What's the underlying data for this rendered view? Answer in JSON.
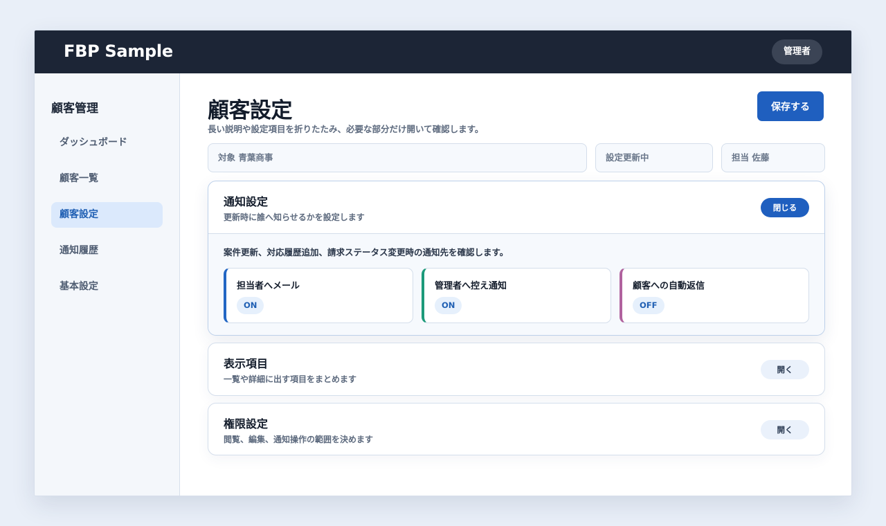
{
  "header": {
    "brand": "FBP Sample",
    "role": "管理者"
  },
  "sidebar": {
    "heading": "顧客管理",
    "items": [
      {
        "label": "ダッシュボード",
        "active": false
      },
      {
        "label": "顧客一覧",
        "active": false
      },
      {
        "label": "顧客設定",
        "active": true
      },
      {
        "label": "通知履歴",
        "active": false
      },
      {
        "label": "基本設定",
        "active": false
      }
    ]
  },
  "page": {
    "title": "顧客設定",
    "description": "長い説明や設定項目を折りたたみ、必要な部分だけ開いて確認します。",
    "save_label": "保存する"
  },
  "filters": {
    "target": "対象 青葉商事",
    "status": "設定更新中",
    "owner": "担当 佐藤"
  },
  "panels": [
    {
      "title": "通知設定",
      "subtitle": "更新時に誰へ知らせるかを設定します",
      "button": "閉じる",
      "expanded": true,
      "note": "案件更新、対応履歴追加、請求ステータス変更時の通知先を確認します。",
      "cards": [
        {
          "title": "担当者へメール",
          "state": "ON",
          "accent": "#2266c4"
        },
        {
          "title": "管理者へ控え通知",
          "state": "ON",
          "accent": "#1c9a7a"
        },
        {
          "title": "顧客への自動返信",
          "state": "OFF",
          "accent": "#b0629e"
        }
      ]
    },
    {
      "title": "表示項目",
      "subtitle": "一覧や詳細に出す項目をまとめます",
      "button": "開く",
      "expanded": false
    },
    {
      "title": "権限設定",
      "subtitle": "閲覧、編集、通知操作の範囲を決めます",
      "button": "開く",
      "expanded": false
    }
  ],
  "colors": {
    "topbar": "#1c2536",
    "accent": "#1f5fbf",
    "active_nav_bg": "#dbe9fc"
  }
}
